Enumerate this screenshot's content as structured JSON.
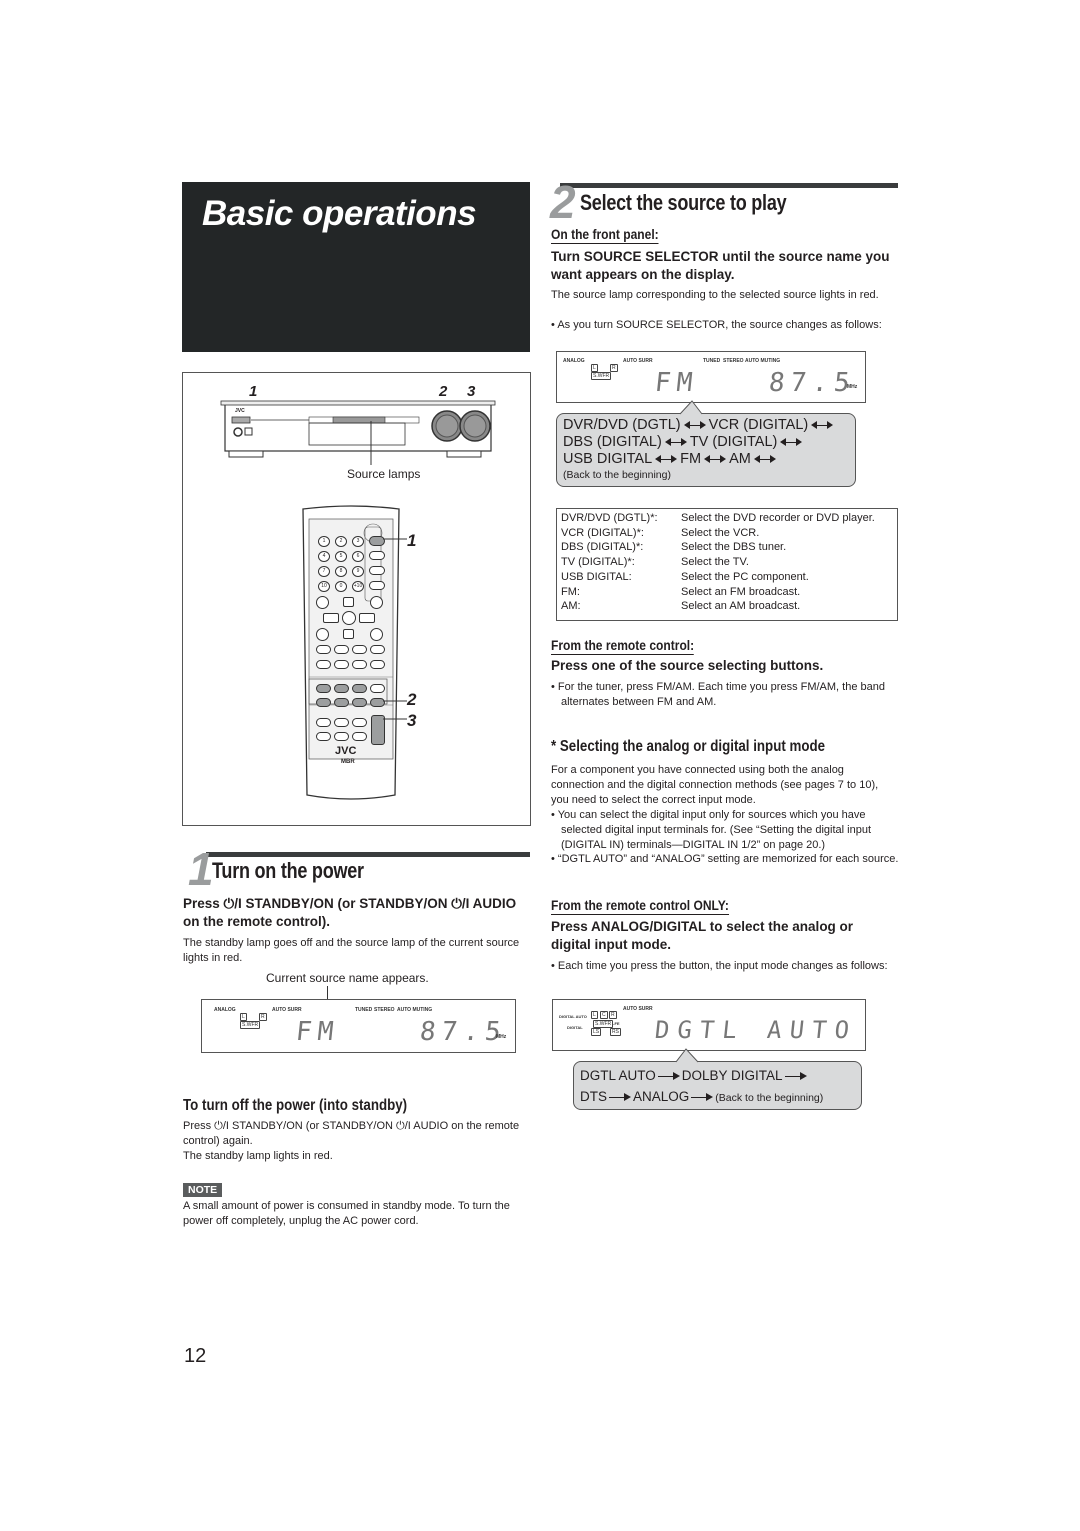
{
  "page": {
    "title": "Basic operations",
    "page_number": "12"
  },
  "section1": {
    "number": "1",
    "title": "Turn on the power",
    "instruction": "Press ⏻/I STANDBY/ON (or STANDBY/ON ⏻/I AUDIO on the remote control).",
    "body": "The standby lamp goes off and the source lamp of the current source lights in red.",
    "display_caption": "Current source name appears.",
    "display": {
      "indicators_left": [
        "ANALOG",
        "AUTO SURR"
      ],
      "indicators_right": [
        "TUNED",
        "STEREO",
        "AUTO MUTING"
      ],
      "channel_boxes": [
        "L",
        "R",
        "S.WFR"
      ],
      "source": "FM",
      "frequency": "87.5",
      "unit": "MHz"
    },
    "standby_heading": "To turn off the power (into standby)",
    "standby_body_1": "Press ⏻/I STANDBY/ON (or STANDBY/ON ⏻/I AUDIO on the remote control) again.",
    "standby_body_2": "The standby lamp lights in red.",
    "note_label": "NOTE",
    "note_text": "A small amount of power is consumed in standby mode. To turn the power off completely, unplug the AC power cord."
  },
  "figure": {
    "front_panel_brand": "JVC",
    "callouts_panel": [
      "1",
      "2",
      "3"
    ],
    "source_lamps_label": "Source lamps",
    "remote_brand": "JVC",
    "remote_sub_brand": "MBR",
    "callouts_remote": [
      "1",
      "2",
      "3"
    ],
    "remote_numbers": [
      "1",
      "2",
      "3",
      "4",
      "5",
      "6",
      "7",
      "8",
      "9",
      "10",
      "0",
      "+10"
    ]
  },
  "section2": {
    "number": "2",
    "title": "Select the source to play",
    "front_panel_heading": "On the front panel:",
    "front_panel_instruction": "Turn SOURCE SELECTOR until the source name you want appears on the display.",
    "front_panel_body": "The source lamp corresponding to the selected source lights in red.",
    "front_panel_bullet": "As you turn SOURCE SELECTOR, the source changes as follows:",
    "display": {
      "indicators_left": [
        "ANALOG",
        "AUTO SURR"
      ],
      "indicators_right": [
        "TUNED",
        "STEREO",
        "AUTO MUTING"
      ],
      "channel_boxes": [
        "L",
        "R",
        "S.WFR"
      ],
      "source": "FM",
      "frequency": "87.5",
      "unit": "MHz"
    },
    "cycle": {
      "row1": [
        "DVR/DVD (DGTL)",
        "VCR (DIGITAL)"
      ],
      "row2": [
        "DBS (DIGITAL)",
        "TV (DIGITAL)"
      ],
      "row3": [
        "USB DIGITAL",
        "FM",
        "AM"
      ],
      "back": "(Back to the beginning)"
    },
    "sources": [
      {
        "key": "DVR/DVD (DGTL)*:",
        "desc": "Select the DVD recorder or DVD player."
      },
      {
        "key": "VCR (DIGITAL)*:",
        "desc": "Select the VCR."
      },
      {
        "key": "DBS (DIGITAL)*:",
        "desc": "Select the DBS tuner."
      },
      {
        "key": "TV (DIGITAL)*:",
        "desc": "Select the TV."
      },
      {
        "key": "USB DIGITAL:",
        "desc": "Select the PC component."
      },
      {
        "key": "FM:",
        "desc": "Select an FM broadcast."
      },
      {
        "key": "AM:",
        "desc": "Select an AM broadcast."
      }
    ],
    "remote_heading": "From the remote control:",
    "remote_instruction": "Press one of the source selecting buttons.",
    "remote_bullet": "For the tuner, press FM/AM. Each time you press FM/AM, the band alternates between FM and AM.",
    "input_mode_heading": "* Selecting the analog or digital input mode",
    "input_mode_body": "For a component you have connected using both the analog connection and the digital connection methods (see pages 7 to 10), you need to select the correct input mode.",
    "input_mode_bullet_1": "You can select the digital input only for sources which you have selected digital input terminals for. (See “Setting the digital input (DIGITAL IN) terminals—DIGITAL IN 1/2” on page 20.)",
    "input_mode_bullet_2": "“DGTL AUTO” and “ANALOG” setting are memorized for each source.",
    "remote_only_heading": "From the remote control ONLY:",
    "remote_only_instruction": "Press ANALOG/DIGITAL to select the analog or digital input mode.",
    "remote_only_bullet": "Each time you press the button, the input mode changes as follows:",
    "display2": {
      "indicators": [
        "DIGITAL AUTO",
        "DIGITAL",
        "AUTO SURR",
        "LFE"
      ],
      "channel_boxes": [
        "L",
        "C",
        "R",
        "S.WFR",
        "LS",
        "RS"
      ],
      "text": "DGTL AUTO"
    },
    "mode_cycle": {
      "row1": [
        "DGTL AUTO",
        "DOLBY DIGITAL"
      ],
      "row2": [
        "DTS",
        "ANALOG"
      ],
      "back": "(Back to the beginning)"
    }
  }
}
